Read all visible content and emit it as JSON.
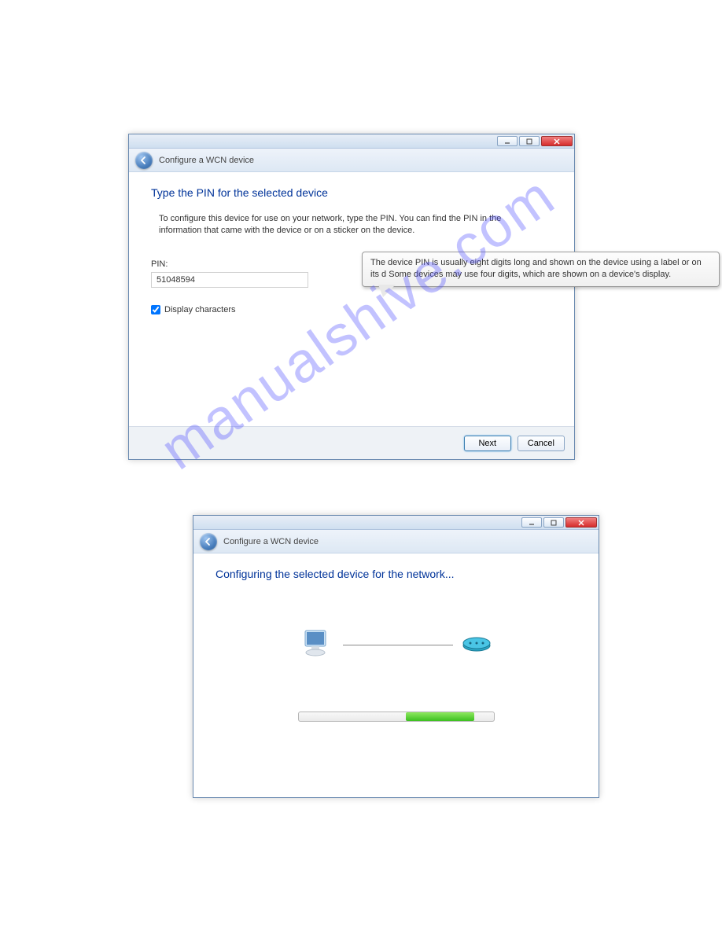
{
  "watermark": "manualshive.com",
  "dialog1": {
    "title": "Configure a WCN device",
    "heading": "Type the PIN for the selected device",
    "instruction": "To configure this device for use on your network, type the PIN. You can find the PIN in the information that came with the device or on a sticker on the device.",
    "pin_label": "PIN:",
    "pin_value": "51048594",
    "display_chars_label": "Display characters",
    "display_chars_checked": true,
    "tooltip": "The device PIN is usually eight digits long and shown on the device using a label or on its d Some devices may use four digits, which are shown on a device's display.",
    "btn_next": "Next",
    "btn_cancel": "Cancel"
  },
  "dialog2": {
    "title": "Configure a WCN device",
    "heading": "Configuring the selected device for the network..."
  }
}
